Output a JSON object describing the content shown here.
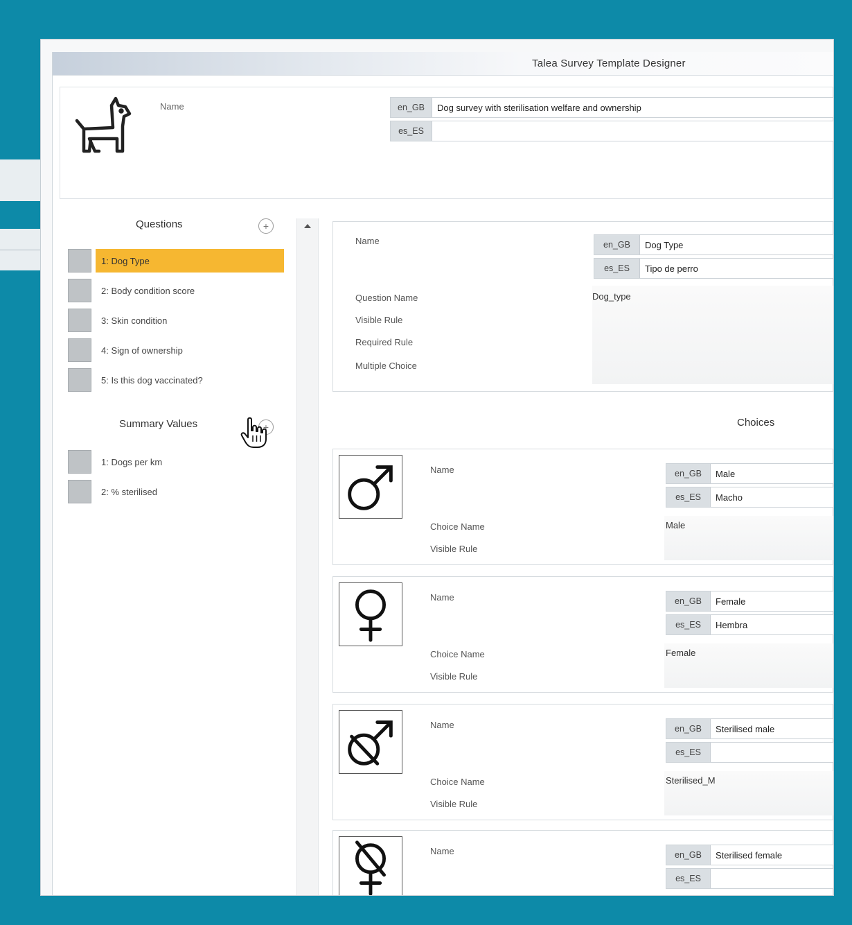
{
  "window": {
    "title": "Talea Survey Template Designer"
  },
  "survey": {
    "name_label": "Name",
    "names": [
      {
        "lang": "en_GB",
        "value": "Dog survey with sterilisation welfare and ownership"
      },
      {
        "lang": "es_ES",
        "value": ""
      }
    ]
  },
  "questions": {
    "title": "Questions",
    "add_icon": "plus-circle-icon",
    "items": [
      {
        "label": "1: Dog Type",
        "selected": true
      },
      {
        "label": "2: Body condition score"
      },
      {
        "label": "3: Skin condition"
      },
      {
        "label": "4: Sign of ownership"
      },
      {
        "label": "5: Is this dog vaccinated?"
      }
    ]
  },
  "summary": {
    "title": "Summary Values",
    "add_icon": "plus-circle-icon",
    "items": [
      {
        "label": "1: Dogs per km"
      },
      {
        "label": "2: % sterilised"
      }
    ]
  },
  "question_detail": {
    "name_label": "Name",
    "names": [
      {
        "lang": "en_GB",
        "value": "Dog Type"
      },
      {
        "lang": "es_ES",
        "value": "Tipo de perro"
      }
    ],
    "question_name_label": "Question Name",
    "question_name_value": "Dog_type",
    "visible_rule_label": "Visible Rule",
    "required_rule_label": "Required Rule",
    "multiple_choice_label": "Multiple Choice"
  },
  "choices": {
    "title": "Choices",
    "labels": {
      "name": "Name",
      "choice_name": "Choice Name",
      "visible_rule": "Visible Rule"
    },
    "items": [
      {
        "icon": "male-symbol-icon",
        "en_GB": "Male",
        "es_ES": "Macho",
        "choice_name": "Male"
      },
      {
        "icon": "female-symbol-icon",
        "en_GB": "Female",
        "es_ES": "Hembra",
        "choice_name": "Female"
      },
      {
        "icon": "sterilised-male-symbol-icon",
        "en_GB": "Sterilised male",
        "es_ES": "",
        "choice_name": "Sterilised_M"
      },
      {
        "icon": "sterilised-female-symbol-icon",
        "en_GB": "Sterilised female",
        "es_ES": "",
        "choice_name": ""
      }
    ]
  },
  "colors": {
    "background": "#0d8aa8",
    "selected": "#f6b731"
  }
}
